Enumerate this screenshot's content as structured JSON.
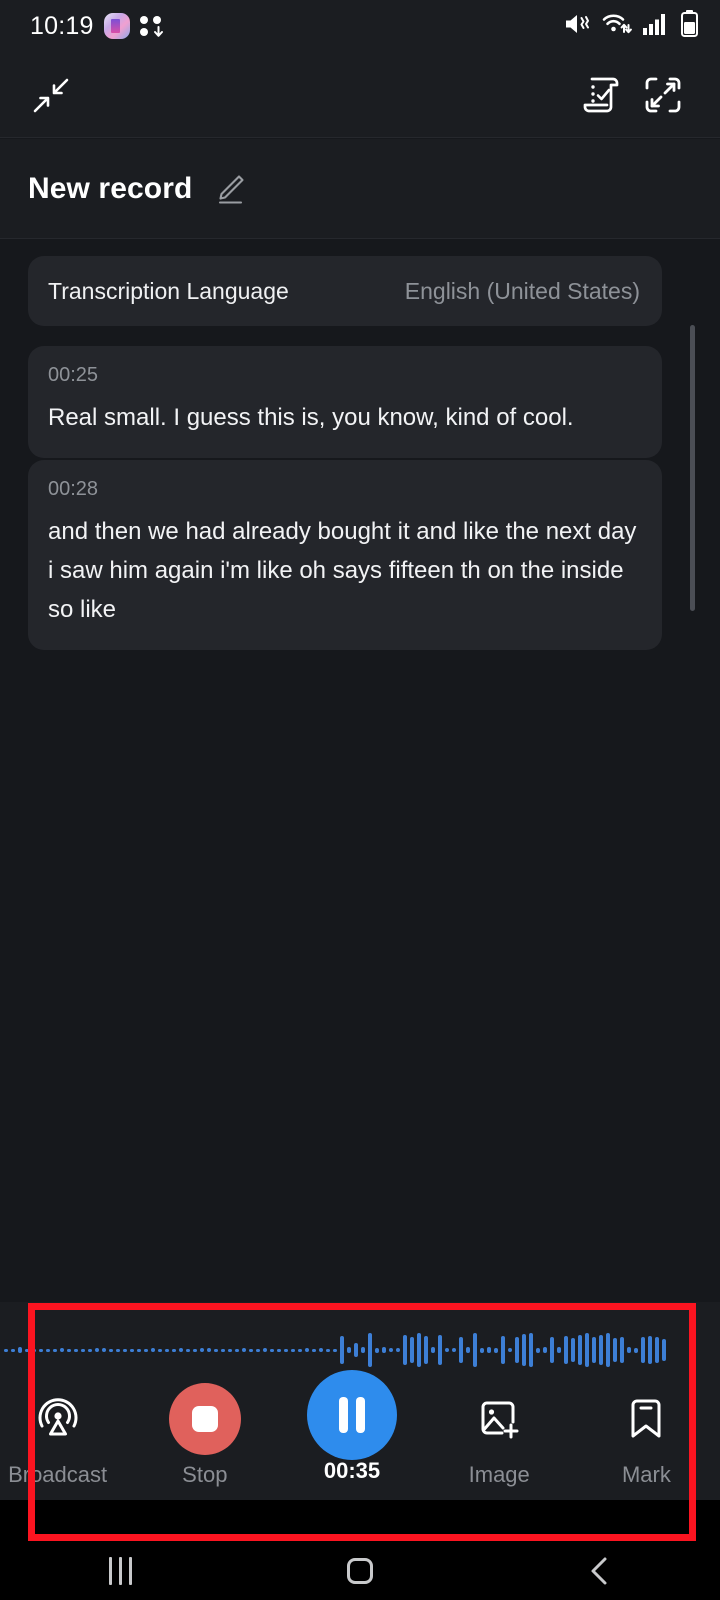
{
  "status_bar": {
    "time": "10:19",
    "icons": [
      "app-badge-icon",
      "dots-download-icon",
      "mute-icon",
      "wifi-icon",
      "signal-icon",
      "battery-icon"
    ],
    "battery_level_pct": 60
  },
  "toolbar": {
    "collapse_icon": "collapse-arrows-icon",
    "transcript_icon": "transcript-scroll-icon",
    "expand_icon": "expand-fullscreen-icon"
  },
  "title_bar": {
    "title": "New record",
    "edit_icon": "pencil-edit-icon"
  },
  "language_card": {
    "label": "Transcription Language",
    "value": "English (United States)"
  },
  "transcript": [
    {
      "time": "00:25",
      "text": "Real small. I guess this is, you know, kind of cool."
    },
    {
      "time": "00:28",
      "text": "and then we had already bought it and like the next day i saw him again i'm like oh says fifteen th on the inside so like"
    }
  ],
  "controls": {
    "broadcast": {
      "label": "Broadcast",
      "icon": "broadcast-icon"
    },
    "stop": {
      "label": "Stop",
      "icon": "stop-square-icon"
    },
    "pause": {
      "label": "00:35",
      "icon": "pause-icon"
    },
    "image": {
      "label": "Image",
      "icon": "add-image-icon"
    },
    "mark": {
      "label": "Mark",
      "icon": "bookmark-mark-icon"
    }
  },
  "waveform": {
    "color": "#3d7fd6",
    "amplitudes": [
      3,
      3,
      6,
      3,
      3,
      3,
      3,
      3,
      4,
      3,
      3,
      3,
      3,
      4,
      4,
      3,
      3,
      3,
      3,
      3,
      3,
      4,
      3,
      3,
      3,
      4,
      3,
      3,
      4,
      4,
      3,
      3,
      3,
      3,
      4,
      3,
      3,
      4,
      3,
      3,
      3,
      3,
      3,
      4,
      3,
      4,
      3,
      3,
      28,
      6,
      14,
      6,
      34,
      5,
      6,
      4,
      4,
      30,
      26,
      34,
      28,
      6,
      30,
      4,
      4,
      26,
      6,
      34,
      5,
      6,
      5,
      28,
      4,
      26,
      32,
      34,
      5,
      6,
      26,
      6,
      28,
      24,
      30,
      34,
      26,
      30,
      34,
      24,
      26,
      6,
      5,
      26,
      28,
      26,
      22
    ]
  },
  "nav_bar": {
    "recents_icon": "recents-icon",
    "home_icon": "home-icon",
    "back_icon": "back-icon"
  },
  "annotation": {
    "highlight_color": "#fb1420"
  },
  "theme": {
    "background": "#16181c",
    "surface": "#1b1d21",
    "card": "#24262b",
    "accent_blue": "#2e8ced",
    "accent_red": "#e0615c",
    "text_primary": "#f2f3f5",
    "text_muted": "#8e9298"
  }
}
